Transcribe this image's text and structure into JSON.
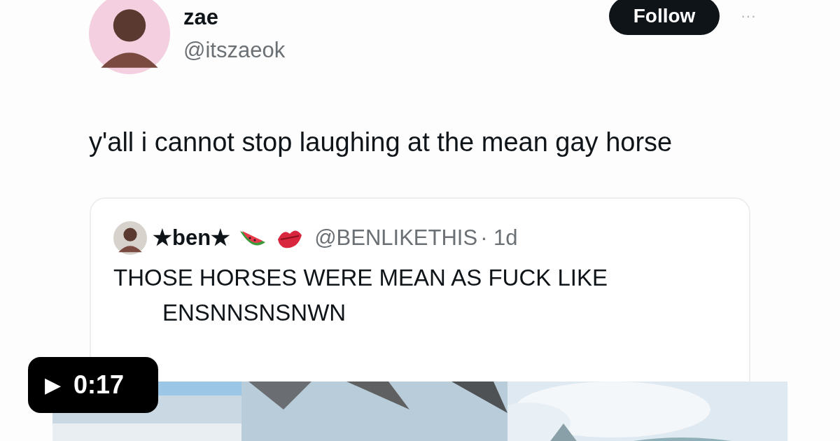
{
  "post": {
    "author": {
      "name": "zae",
      "handle": "@itszaeok"
    },
    "follow_button": "Follow",
    "more_button": "···",
    "text": "y'all i cannot stop laughing at the mean gay horse",
    "quoted_post": {
      "author": {
        "name": "★ben★",
        "handle": "@BENLIKETHIS",
        "time": "· 1d"
      },
      "text_lines": [
        "THOSE HORSES WERE MEAN AS FUCK LIKE",
        "ENSNNSNSNWN"
      ]
    }
  },
  "video_badge": {
    "play_icon": "▶",
    "duration": "0:17"
  }
}
